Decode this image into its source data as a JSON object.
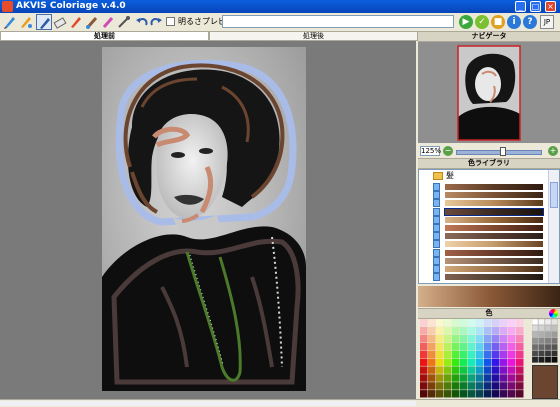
{
  "window": {
    "title": "AKVIS Coloriage v.4.0",
    "buttons": {
      "minimize": "_",
      "maximize": "□",
      "close": "×"
    }
  },
  "toolbar": {
    "tools": [
      "pencil-tool-icon",
      "auto-pencil-icon",
      "magic-tube-icon",
      "brush-icon",
      "eraser-icon",
      "color-pencil-icon",
      "brush-2-icon",
      "eyedropper-icon",
      "undo-icon",
      "redo-icon"
    ],
    "preview_label": "明るさプレビュー",
    "path_value": "",
    "run_icon": "play-icon",
    "apply_icon": "check-icon",
    "info_icon": "info-icon",
    "help_icon": "help-icon",
    "language_label": "JP"
  },
  "tabs": [
    {
      "label": "処理前",
      "active": true
    },
    {
      "label": "処理後",
      "active": false
    }
  ],
  "navigator": {
    "title": "ナビゲータ",
    "zoom": "125%",
    "zoom_level_fraction": 0.56,
    "zoom_out_label": "−",
    "zoom_in_label": "+"
  },
  "library": {
    "title": "色ライブラリ",
    "folder_label": "髪",
    "gradients": [
      [
        "#9c6a4a",
        "#5a3a24",
        "#2e1a10"
      ],
      [
        "#b88a62",
        "#7a5234",
        "#3a2412"
      ],
      [
        "#e8c89a",
        "#b88a5a",
        "#5a3a1a"
      ],
      [
        "#6a4a3a",
        "#3a2a20",
        "#1a120c"
      ],
      [
        "#d8b48a",
        "#9a6a3a",
        "#4a2a12"
      ],
      [
        "#c07858",
        "#804830",
        "#401e10"
      ],
      [
        "#8a6a5a",
        "#5a4034",
        "#2a1e18"
      ],
      [
        "#f0d2a8",
        "#c49a6a",
        "#6a4424"
      ],
      [
        "#a06048",
        "#6a3a28",
        "#301a10"
      ],
      [
        "#b49278",
        "#7a5e4a",
        "#3a2c22"
      ],
      [
        "#d0a878",
        "#9a7048",
        "#4a3018"
      ],
      [
        "#806050",
        "#504030",
        "#201810"
      ]
    ],
    "selected_index": 3
  },
  "color_panel": {
    "title": "色",
    "current_color": "#6b4530",
    "preview_gradient": [
      "#d4b08a",
      "#8c5a38",
      "#3a2414"
    ]
  },
  "colors": {
    "accent": "#0a5fdc",
    "canvas_bg": "#7a7a7a",
    "stroke_hair": "#6b4530",
    "stroke_skin": "#c98a72",
    "stroke_outline": "#4a3a3a",
    "stroke_necklace": "#4a7a2a",
    "stroke_background": "#a9bce8"
  }
}
